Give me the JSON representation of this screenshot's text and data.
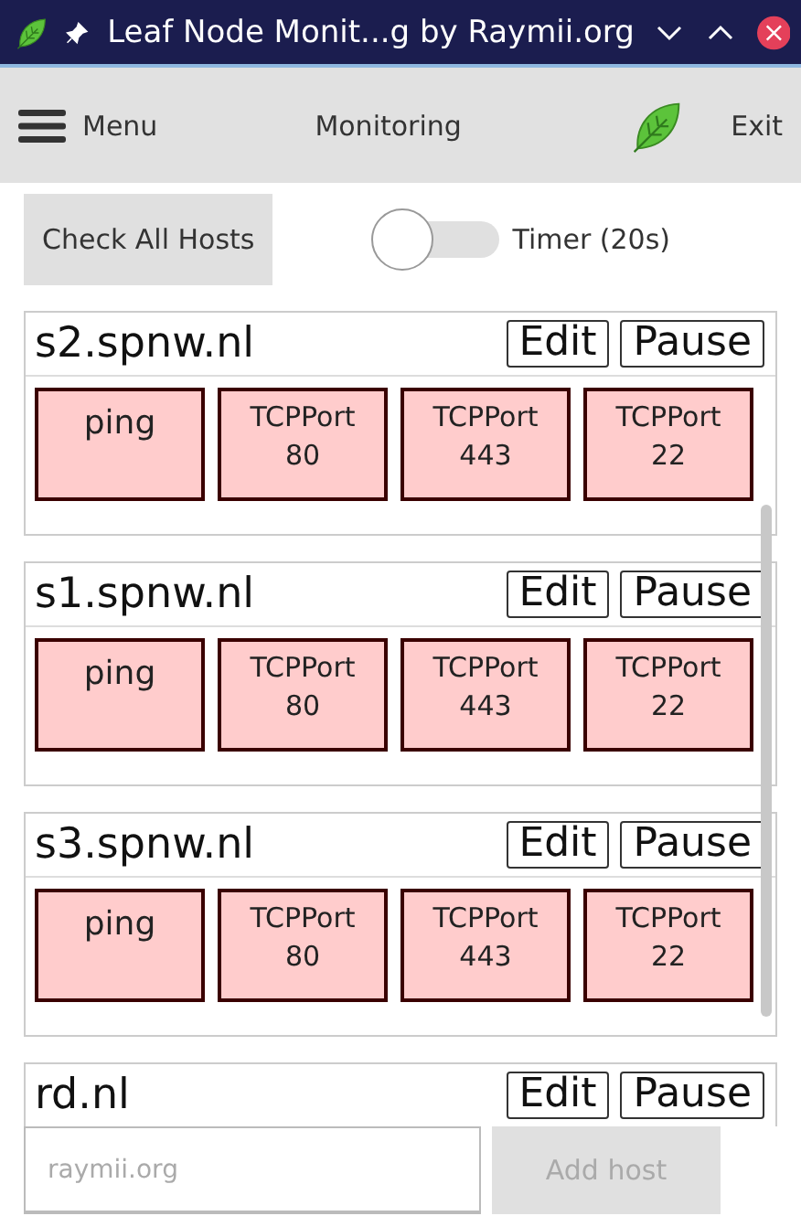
{
  "window": {
    "title": "Leaf Node Monit...g by Raymii.org"
  },
  "toolbar": {
    "menu_label": "Menu",
    "title": "Monitoring",
    "exit_label": "Exit"
  },
  "controls": {
    "check_all_label": "Check All Hosts",
    "timer": {
      "label": "Timer (20s)",
      "on": false
    }
  },
  "hosts": [
    {
      "name": "s2.spnw.nl",
      "edit_label": "Edit",
      "pause_label": "Pause",
      "checks": [
        {
          "lines": [
            "ping"
          ]
        },
        {
          "lines": [
            "TCPPort",
            "80"
          ]
        },
        {
          "lines": [
            "TCPPort",
            "443"
          ]
        },
        {
          "lines": [
            "TCPPort",
            "22"
          ]
        }
      ]
    },
    {
      "name": "s1.spnw.nl",
      "edit_label": "Edit",
      "pause_label": "Pause",
      "checks": [
        {
          "lines": [
            "ping"
          ]
        },
        {
          "lines": [
            "TCPPort",
            "80"
          ]
        },
        {
          "lines": [
            "TCPPort",
            "443"
          ]
        },
        {
          "lines": [
            "TCPPort",
            "22"
          ]
        }
      ]
    },
    {
      "name": "s3.spnw.nl",
      "edit_label": "Edit",
      "pause_label": "Pause",
      "checks": [
        {
          "lines": [
            "ping"
          ]
        },
        {
          "lines": [
            "TCPPort",
            "80"
          ]
        },
        {
          "lines": [
            "TCPPort",
            "443"
          ]
        },
        {
          "lines": [
            "TCPPort",
            "22"
          ]
        }
      ]
    },
    {
      "name": "rd.nl",
      "edit_label": "Edit",
      "pause_label": "Pause"
    }
  ],
  "add_host": {
    "placeholder": "raymii.org",
    "button_label": "Add host"
  }
}
